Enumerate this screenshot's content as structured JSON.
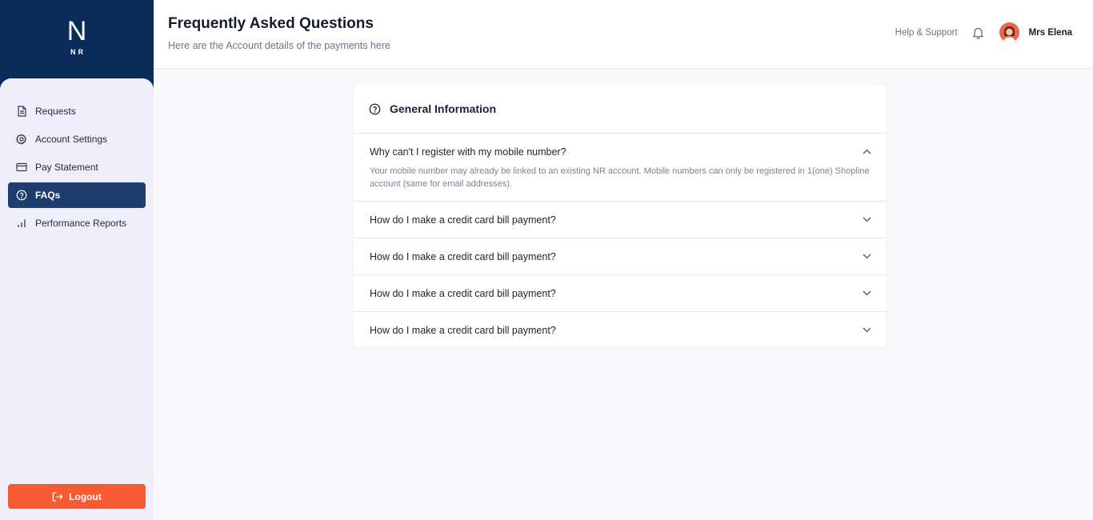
{
  "brand": {
    "mark": "N",
    "sub": "NR"
  },
  "sidebar": {
    "items": [
      {
        "label": "Requests",
        "icon": "file-icon"
      },
      {
        "label": "Account Settings",
        "icon": "gear-icon"
      },
      {
        "label": "Pay Statement",
        "icon": "credit-card-icon"
      },
      {
        "label": "FAQs",
        "icon": "question-circle-icon",
        "active": true
      },
      {
        "label": "Performance Reports",
        "icon": "bar-chart-icon"
      }
    ],
    "logout_label": "Logout"
  },
  "header": {
    "title": "Frequently Asked Questions",
    "subtitle": "Here are the Account details of the payments here",
    "help_label": "Help & Support",
    "user_name": "Mrs Elena"
  },
  "faq": {
    "section_title": "General Information",
    "items": [
      {
        "question": "Why can't I register with my mobile number?",
        "answer": "Your mobile number may already be linked to an existing NR account. Mobile numbers can only be registered in 1(one) Shopline account (same for email addresses).",
        "open": true
      },
      {
        "question": "How do I make a credit card bill payment?",
        "open": false
      },
      {
        "question": "How do I make a credit card bill payment?",
        "open": false
      },
      {
        "question": "How do I make a credit card bill payment?",
        "open": false
      },
      {
        "question": "How do I make a credit card bill payment?",
        "open": false
      }
    ]
  },
  "colors": {
    "sidebar_bg": "#0b2c5a",
    "nav_panel_bg": "#efeef9",
    "active_item_bg": "#1d3d6e",
    "logout_bg": "#f85a31",
    "avatar_bg": "#e9694a"
  }
}
